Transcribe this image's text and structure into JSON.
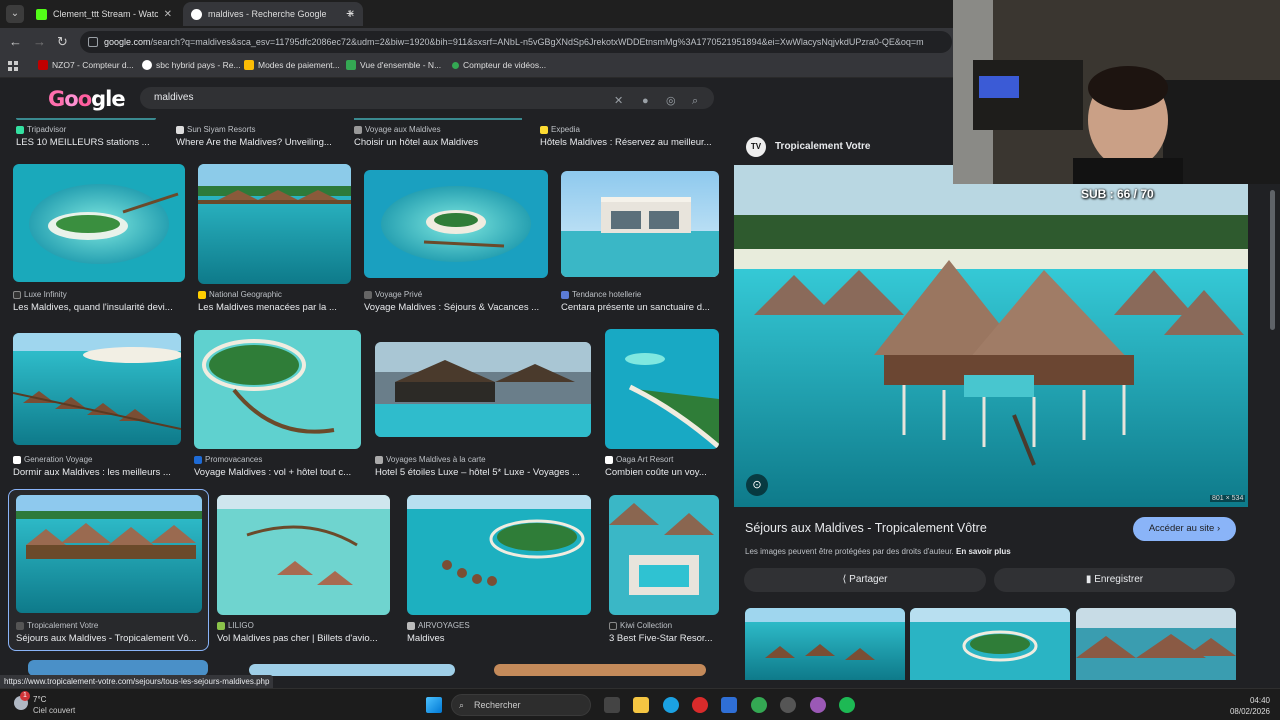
{
  "browser": {
    "tabs": [
      {
        "label": "Clement_ttt Stream - Watch Live",
        "color": "#53fc18"
      },
      {
        "label": "maldives - Recherche Google",
        "color": "#4285f4"
      }
    ],
    "url_host": "google.com",
    "url_rest": "/search?q=maldives&sca_esv=11795dfc2086ec72&udm=2&biw=1920&bih=911&sxsrf=ANbL-n5vGBgXNdSp6JrekotxWDDEtnsmMg%3A1770521951894&ei=XwWlacysNqjvkdUPzra0-QE&oq=m",
    "bookmarks": [
      {
        "label": "NZO7 - Compteur d...",
        "color": "#c00000"
      },
      {
        "label": "sbc hybrid pays - Re...",
        "color": "#ffffff"
      },
      {
        "label": "Modes de paiement...",
        "color": "#fbbc05"
      },
      {
        "label": "Vue d'ensemble - N...",
        "color": "#34a853"
      },
      {
        "label": "Compteur de vidéos...",
        "color": "#34a853"
      }
    ],
    "status_url": "https://www.tropicalement-votre.com/sejours/tous-les-sejours-maldives.php"
  },
  "google": {
    "logo": "Google",
    "query": "maldives"
  },
  "results": {
    "row0": [
      {
        "source": "Tripadvisor",
        "title": "LES 10 MEILLEURS stations ...",
        "icon": "#34e0a1"
      },
      {
        "source": "Sun Siyam Resorts",
        "title": "Where Are the Maldives? Unveiling...",
        "icon": "#dddddd"
      },
      {
        "source": "Voyage aux Maldives",
        "title": "Choisir un hôtel aux Maldives",
        "icon": "#999999"
      },
      {
        "source": "Expedia",
        "title": "Hôtels Maldives : Réservez au meilleur...",
        "icon": "#fddb32"
      }
    ],
    "row1": [
      {
        "source": "Luxe Infinity",
        "title": "Les Maldives, quand l'insularité devi...",
        "icon": "#333333"
      },
      {
        "source": "National Geographic",
        "title": "Les Maldives menacées par la ...",
        "icon": "#ffce00"
      },
      {
        "source": "Voyage Privé",
        "title": "Voyage Maldives : Séjours & Vacances ...",
        "icon": "#666666"
      },
      {
        "source": "Tendance hotellerie",
        "title": "Centara présente un sanctuaire d...",
        "icon": "#5b7bd5"
      }
    ],
    "row2": [
      {
        "source": "Generation Voyage",
        "title": "Dormir aux Maldives : les meilleurs ...",
        "icon": "#ffffff"
      },
      {
        "source": "Promovacances",
        "title": "Voyage Maldives : vol + hôtel tout c...",
        "icon": "#1e6bd6"
      },
      {
        "source": "Voyages Maldives à la carte",
        "title": "Hotel 5 étoiles Luxe – hôtel 5* Luxe - Voyages ...",
        "icon": "#aaaaaa"
      },
      {
        "source": "Oaga Art Resort",
        "title": "Combien coûte un voy...",
        "icon": "#ffffff"
      }
    ],
    "row3": [
      {
        "source": "Tropicalement Votre",
        "title": "Séjours aux Maldives - Tropicalement Vô...",
        "icon": "#555555"
      },
      {
        "source": "LILIGO",
        "title": "Vol Maldives pas cher | Billets d'avio...",
        "icon": "#8bc34a"
      },
      {
        "source": "AIRVOYAGES",
        "title": "Maldives",
        "icon": "#bbbbbb"
      },
      {
        "source": "Kiwi Collection",
        "title": "3 Best Five-Star Resor...",
        "icon": "#222222"
      }
    ]
  },
  "panel": {
    "logo_text": "TV",
    "source": "Tropicalement Votre",
    "dimensions": "801 × 534",
    "title": "Séjours aux Maldives - Tropicalement Vôtre",
    "visit_label": "Accéder au site",
    "copyright": "Les images peuvent être protégées par des droits d'auteur.",
    "learn_more": "En savoir plus",
    "share_label": "Partager",
    "save_label": "Enregistrer"
  },
  "overlay": {
    "subs": "SUB : 66 / 70"
  },
  "taskbar": {
    "temp": "7°C",
    "condition": "Ciel couvert",
    "badge": "1",
    "search_placeholder": "Rechercher",
    "time": "04:40",
    "date": "08/02/2026"
  }
}
